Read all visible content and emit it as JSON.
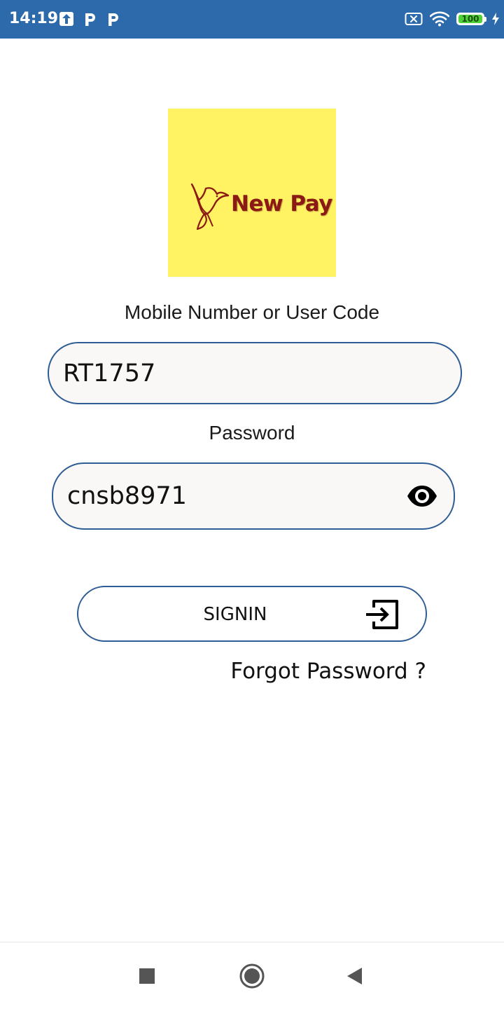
{
  "status_bar": {
    "time": "14:19",
    "battery_level": "100",
    "icons": [
      "upload-icon",
      "p-icon",
      "p-icon",
      "no-sim-icon",
      "wifi-icon",
      "battery-icon",
      "charging-icon"
    ],
    "background_color": "#2d6aab"
  },
  "logo": {
    "text": "New Pay",
    "background_color": "#fff263",
    "text_color": "#8b1a14"
  },
  "login_form": {
    "user_label": "Mobile Number or User Code",
    "user_value": "RT1757",
    "password_label": "Password",
    "password_value": "cnsb8971",
    "signin_label": "SIGNIN",
    "forgot_label": "Forgot Password ?",
    "border_color": "#2d5d94"
  },
  "nav_bar": {
    "icons": [
      "recent-apps-icon",
      "home-icon",
      "back-icon"
    ]
  }
}
